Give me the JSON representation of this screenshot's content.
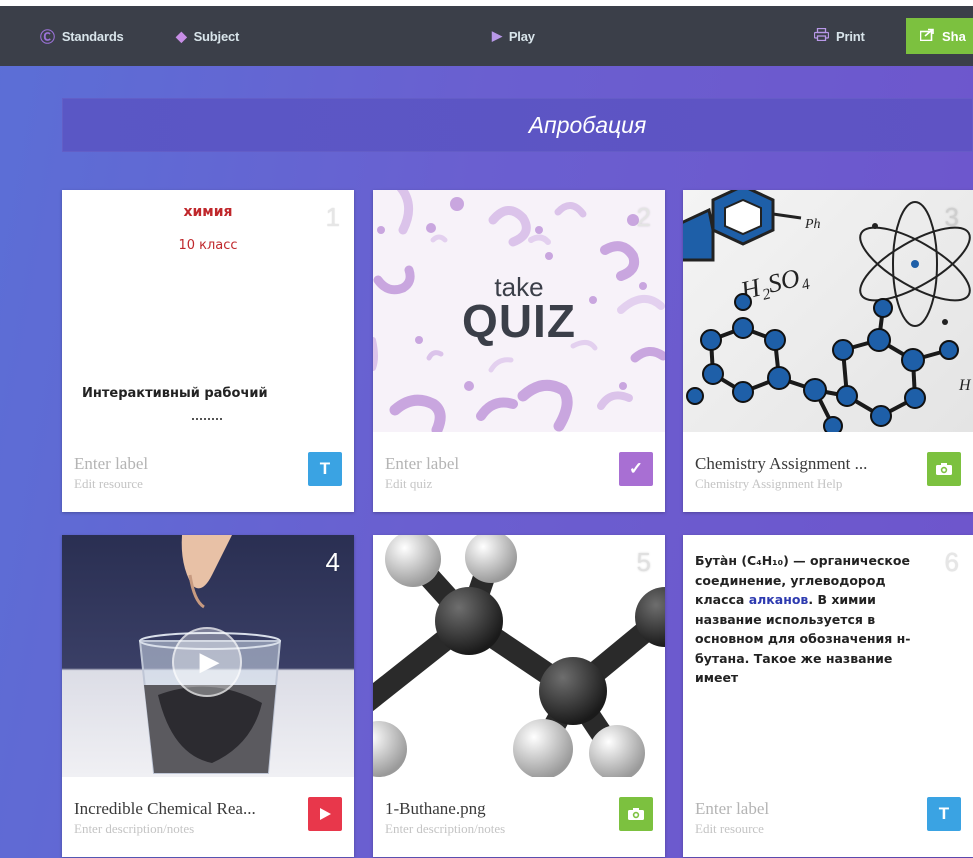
{
  "topbar": {
    "standards_label": "Standards",
    "subject_label": "Subject",
    "play_label": "Play",
    "print_label": "Print",
    "share_label": "Sha",
    "icons": {
      "standards": "standards-icon",
      "subject": "tag-icon",
      "play": "play-icon",
      "print": "printer-icon",
      "share": "share-icon"
    }
  },
  "board": {
    "title": "Апробация"
  },
  "colors": {
    "topbar": "#3b3f49",
    "share": "#7cc13f",
    "text_tile": "#3aa3e3",
    "quiz_tile": "#a86fd3",
    "image_tile": "#7cc13f",
    "video_tile": "#e8374b"
  },
  "cards": [
    {
      "number": "1",
      "heading": "химия",
      "subheading": "10 класс",
      "body": "Интерактивный рабочий",
      "label": "Enter label",
      "sub": "Edit resource",
      "type_icon": "text-icon",
      "type_glyph": "T"
    },
    {
      "number": "2",
      "take": "take",
      "quiz": "QUIZ",
      "label": "Enter label",
      "sub": "Edit quiz",
      "type_icon": "check-icon",
      "type_glyph": "✓"
    },
    {
      "number": "3",
      "formula": "H₂SO₄",
      "formula_tag": "Ph",
      "label": "Chemistry Assignment ...",
      "sub": "Chemistry Assignment Help",
      "type_icon": "camera-icon"
    },
    {
      "number": "4",
      "label": "Incredible Chemical Rea...",
      "sub": "Enter description/notes",
      "type_icon": "video-icon"
    },
    {
      "number": "5",
      "label": "1-Buthane.png",
      "sub": "Enter description/notes",
      "type_icon": "camera-icon"
    },
    {
      "number": "6",
      "text_pre": "Бута̀н (C₄H₁₀) — органическое соединение, углеводород класса ",
      "text_link": "алканов",
      "text_post": ". В химии название используется в основном для обозначения н-бутана. Такое же название имеет",
      "label": "Enter label",
      "sub": "Edit resource",
      "type_icon": "text-icon",
      "type_glyph": "T"
    }
  ]
}
